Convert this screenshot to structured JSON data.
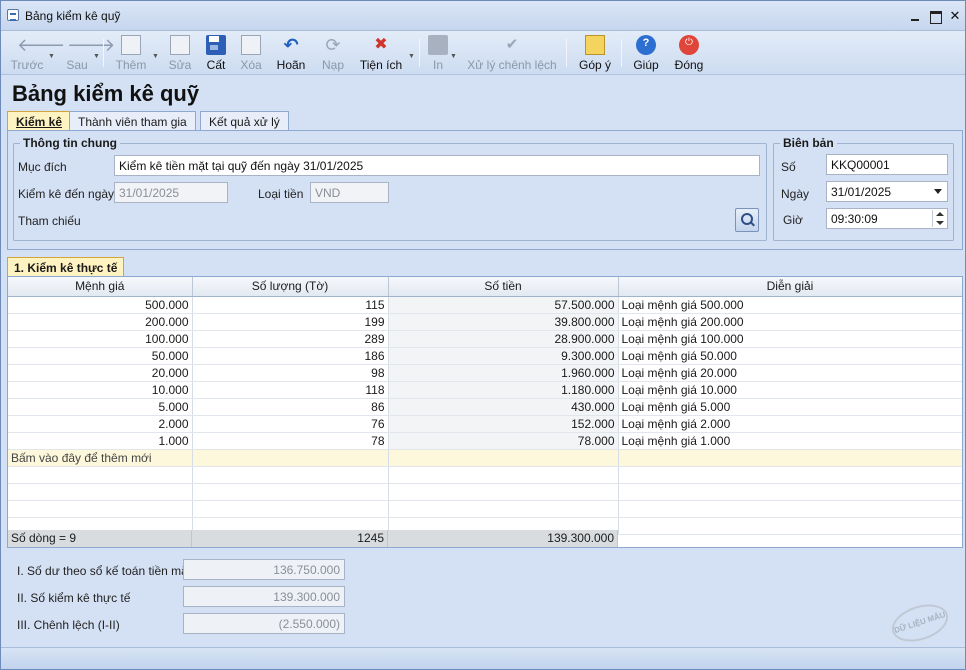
{
  "window": {
    "title": "Bảng kiểm kê quỹ"
  },
  "toolbar": {
    "back": "Trước",
    "forward": "Sau",
    "add": "Thêm",
    "edit": "Sửa",
    "save": "Cất",
    "delete": "Xóa",
    "undo": "Hoãn",
    "reload": "Nạp",
    "utilities": "Tiện ích",
    "print": "In",
    "process": "Xử lý chênh lệch",
    "feedback": "Góp ý",
    "help": "Giúp",
    "close": "Đóng"
  },
  "page_title": "Bảng kiểm kê quỹ",
  "tabs": [
    {
      "label": "Kiểm kê",
      "active": true
    },
    {
      "label": "Thành viên tham gia",
      "active": false
    },
    {
      "label": "Kết quả xử lý",
      "active": false
    }
  ],
  "general": {
    "title": "Thông tin chung",
    "purpose_label": "Mục đích",
    "purpose_value": "Kiểm kê tiền mặt tại quỹ đến ngày 31/01/2025",
    "date_label": "Kiểm kê đến ngày",
    "date_value": "31/01/2025",
    "currency_label": "Loại tiền",
    "currency_value": "VND",
    "reference_label": "Tham chiếu"
  },
  "minutes": {
    "title": "Biên bản",
    "number_label": "Số",
    "number_value": "KKQ00001",
    "date_label": "Ngày",
    "date_value": "31/01/2025",
    "time_label": "Giờ",
    "time_value": "09:30:09"
  },
  "section_tab": "1. Kiểm kê thực tế",
  "grid": {
    "headers": [
      "Mệnh giá",
      "Số lượng (Tờ)",
      "Số tiền",
      "Diễn giải"
    ],
    "rows": [
      [
        "500.000",
        "115",
        "57.500.000",
        "Loại mệnh giá 500.000"
      ],
      [
        "200.000",
        "199",
        "39.800.000",
        "Loại mệnh giá 200.000"
      ],
      [
        "100.000",
        "289",
        "28.900.000",
        "Loại mệnh giá 100.000"
      ],
      [
        "50.000",
        "186",
        "9.300.000",
        "Loại mệnh giá 50.000"
      ],
      [
        "20.000",
        "98",
        "1.960.000",
        "Loại mệnh giá 20.000"
      ],
      [
        "10.000",
        "118",
        "1.180.000",
        "Loại mệnh giá 10.000"
      ],
      [
        "5.000",
        "86",
        "430.000",
        "Loại mệnh giá 5.000"
      ],
      [
        "2.000",
        "76",
        "152.000",
        "Loại mệnh giá 2.000"
      ],
      [
        "1.000",
        "78",
        "78.000",
        "Loại mệnh giá 1.000"
      ]
    ],
    "add_row_text": "Bấm vào đây để thêm mới",
    "footer_count": "Số dòng = 9",
    "footer_quantity": "1245",
    "footer_amount": "139.300.000"
  },
  "summary": {
    "book_label": "I. Số dư theo sổ kế toán tiền mặt",
    "book_value": "136.750.000",
    "actual_label": "II. Số kiểm kê thực tế",
    "actual_value": "139.300.000",
    "diff_label": "III. Chênh lệch (I-II)",
    "diff_value": "(2.550.000)"
  },
  "watermark": "DỮ LIỆU MẪU"
}
